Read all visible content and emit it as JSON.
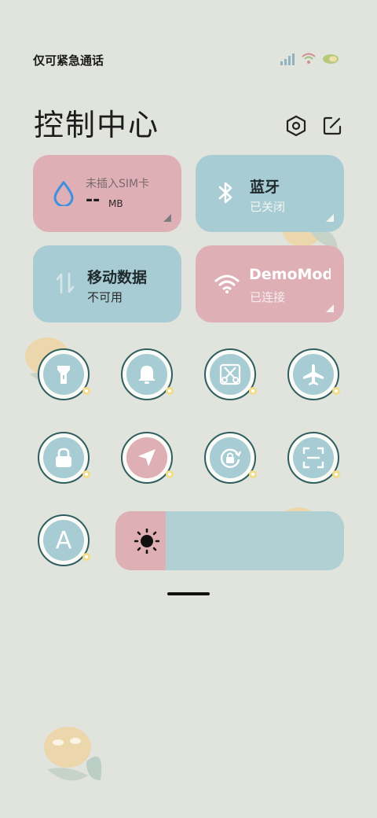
{
  "status_bar": {
    "carrier_text": "仅可紧急通话",
    "icons": [
      "signal-icon",
      "wifi-icon",
      "battery-icon"
    ]
  },
  "header": {
    "title": "控制中心",
    "settings_icon": "gear-icon",
    "edit_icon": "edit-icon"
  },
  "tiles": {
    "data": {
      "label": "未插入SIM卡",
      "value": "--",
      "unit": "MB",
      "icon": "water-drop-icon"
    },
    "bluetooth": {
      "label": "蓝牙",
      "status": "已关闭",
      "icon": "bluetooth-icon"
    },
    "mobile_data": {
      "label": "移动数据",
      "status": "不可用",
      "icon": "data-arrows-icon"
    },
    "wifi": {
      "label": "DemoMod",
      "status": "已连接",
      "icon": "wifi-icon"
    }
  },
  "toggles": [
    {
      "name": "flashlight",
      "icon": "flashlight-icon",
      "active": false
    },
    {
      "name": "mute",
      "icon": "bell-icon",
      "active": false
    },
    {
      "name": "screenshot",
      "icon": "scissors-icon",
      "active": false
    },
    {
      "name": "airplane",
      "icon": "airplane-icon",
      "active": false
    },
    {
      "name": "lock",
      "icon": "lock-icon",
      "active": false
    },
    {
      "name": "location",
      "icon": "location-arrow-icon",
      "active": true
    },
    {
      "name": "auto-rotate",
      "icon": "rotate-lock-icon",
      "active": false
    },
    {
      "name": "scanner",
      "icon": "scan-icon",
      "active": false
    },
    {
      "name": "auto-brightness",
      "icon": "letter-a-icon",
      "active": false
    }
  ],
  "auto_brightness_letter": "A",
  "brightness": {
    "level": 0.22,
    "icon": "sun-icon"
  },
  "colors": {
    "background": "#e1e4dc",
    "pink": "#dfafb6",
    "blue": "#a8ccd3",
    "ring": "#2f5e5e"
  }
}
